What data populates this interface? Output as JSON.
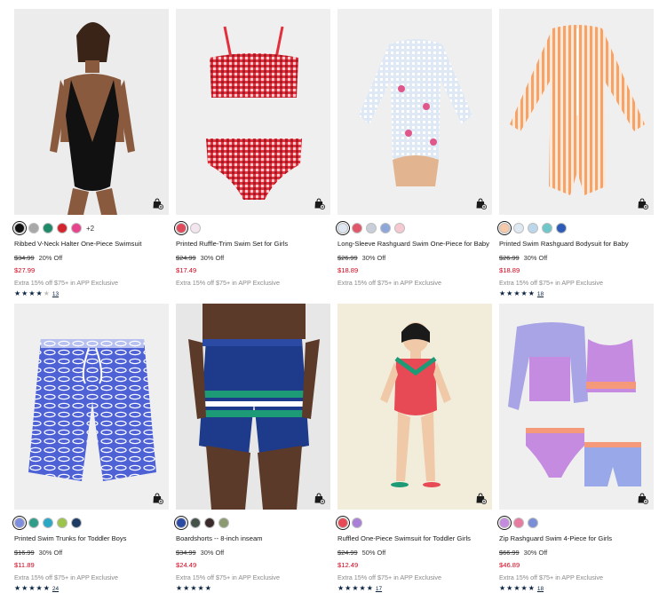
{
  "products": [
    {
      "name": "Ribbed V-Neck Halter One-Piece Swimsuit",
      "bg": "#ececec",
      "swatches": [
        "#111111",
        "#a8a8a8",
        "#1f8a6a",
        "#d4252f",
        "#e8448e"
      ],
      "more": "+2",
      "orig": "$34.99",
      "off": "20% Off",
      "sale": "$27.99",
      "extra": "Extra 15% off $75+ in APP Exclusive",
      "rating": 4,
      "count": "13",
      "icon": "swimsuit-model-image"
    },
    {
      "name": "Printed Ruffle-Trim Swim Set for Girls",
      "bg": "#efefef",
      "swatches": [
        "#e04a5a",
        "#f3e6ee"
      ],
      "more": "",
      "orig": "$24.99",
      "off": "30% Off",
      "sale": "$17.49",
      "extra": "Extra 15% off $75+ in APP Exclusive",
      "rating": 0,
      "count": "",
      "icon": "bikini-set-image"
    },
    {
      "name": "Long-Sleeve Rashguard Swim One-Piece for Baby",
      "bg": "#efefef",
      "swatches": [
        "#dfe7f2",
        "#e0576a",
        "#c9cfd8",
        "#8ea6da",
        "#f5c9cf"
      ],
      "more": "",
      "orig": "$26.99",
      "off": "30% Off",
      "sale": "$18.89",
      "extra": "Extra 15% off $75+ in APP Exclusive",
      "rating": 0,
      "count": "",
      "icon": "rashguard-onepiece-image"
    },
    {
      "name": "Printed Swim Rashguard Bodysuit for Baby",
      "bg": "#efefef",
      "swatches": [
        "#f7c9a9",
        "#dfe9f3",
        "#bcd6ea",
        "#6fc7c9",
        "#2e5bb8"
      ],
      "more": "",
      "orig": "$26.99",
      "off": "30% Off",
      "sale": "$18.89",
      "extra": "Extra 15% off $75+ in APP Exclusive",
      "rating": 5,
      "count": "18",
      "icon": "rashguard-bodysuit-image"
    },
    {
      "name": "Printed Swim Trunks for Toddler Boys",
      "bg": "#efefef",
      "swatches": [
        "#7f8fe0",
        "#2f9d8a",
        "#2aa8c6",
        "#9cc44a",
        "#1d3b63"
      ],
      "more": "",
      "orig": "$16.99",
      "off": "30% Off",
      "sale": "$11.89",
      "extra": "Extra 15% off $75+ in APP Exclusive",
      "rating": 5,
      "count": "24",
      "icon": "swim-trunks-image"
    },
    {
      "name": "Boardshorts -- 8-inch inseam",
      "bg": "#e7e7e7",
      "swatches": [
        "#2a4aa3",
        "#44524a",
        "#3a2a2a",
        "#8c9a72"
      ],
      "more": "",
      "orig": "$34.99",
      "off": "30% Off",
      "sale": "$24.49",
      "extra": "Extra 15% off $75+ in APP Exclusive",
      "rating": 5,
      "count": "",
      "icon": "boardshorts-model-image"
    },
    {
      "name": "Ruffled One-Piece Swimsuit for Toddler Girls",
      "bg": "#f2eddb",
      "swatches": [
        "#e84a55",
        "#a97fd8"
      ],
      "more": "",
      "orig": "$24.99",
      "off": "50% Off",
      "sale": "$12.49",
      "extra": "Extra 15% off $75+ in APP Exclusive",
      "rating": 5,
      "count": "17",
      "icon": "toddler-swimsuit-image"
    },
    {
      "name": "Zip Rashguard Swim 4-Piece for Girls",
      "bg": "#efefef",
      "swatches": [
        "#c58be0",
        "#e87ba0",
        "#7a8fd8"
      ],
      "more": "",
      "orig": "$66.99",
      "off": "30% Off",
      "sale": "$46.89",
      "extra": "Extra 15% off $75+ in APP Exclusive",
      "rating": 5,
      "count": "18",
      "icon": "four-piece-set-image"
    }
  ]
}
